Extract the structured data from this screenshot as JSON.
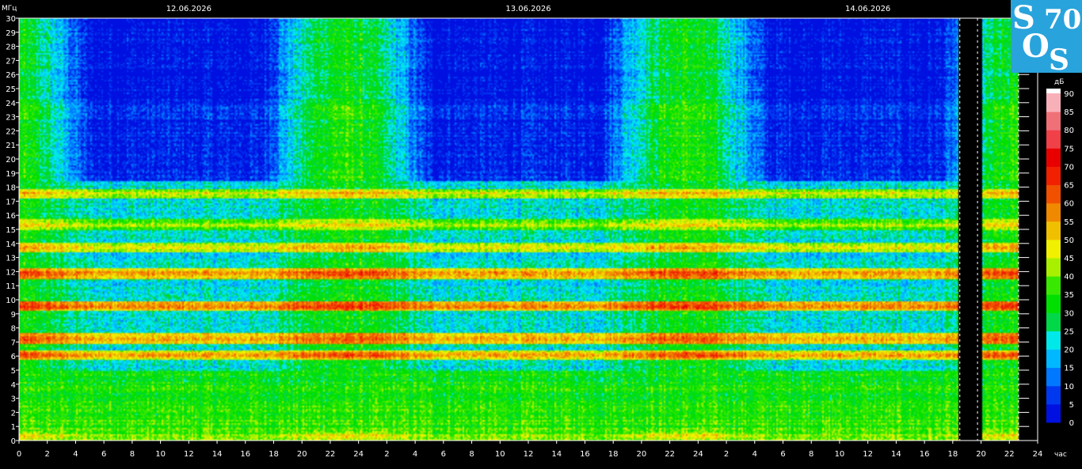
{
  "chart_data": {
    "type": "heatmap",
    "title": "",
    "y_unit_label": "МГц",
    "x_unit_label": "час",
    "colorbar_unit_label": "дБ",
    "dates": [
      "12.06.2026",
      "13.06.2026",
      "14.06.2026"
    ],
    "ylim": [
      0,
      30
    ],
    "y_ticks": [
      0,
      1,
      2,
      3,
      4,
      5,
      6,
      7,
      8,
      9,
      10,
      11,
      12,
      13,
      14,
      15,
      16,
      17,
      18,
      19,
      20,
      21,
      22,
      23,
      24,
      25,
      26,
      27,
      28,
      29,
      30
    ],
    "x_hours_range": [
      0,
      72
    ],
    "x_tick_labels": [
      "0",
      "2",
      "4",
      "6",
      "8",
      "10",
      "12",
      "14",
      "16",
      "18",
      "20",
      "22",
      "24",
      "2",
      "4",
      "6",
      "8",
      "10",
      "12",
      "14",
      "16",
      "18",
      "20",
      "22",
      "24",
      "2",
      "4",
      "6",
      "8",
      "10",
      "12",
      "14",
      "16",
      "18",
      "20",
      "22",
      "24"
    ],
    "data_end_hour": 66.3,
    "gap_hours": [
      66.3,
      68.0
    ],
    "resume_end_hour": 70.6,
    "colorbar_range": [
      0,
      90
    ],
    "colorbar_ticks": [
      0,
      5,
      10,
      15,
      20,
      25,
      30,
      35,
      40,
      45,
      50,
      55,
      60,
      65,
      70,
      75,
      80,
      85,
      90
    ],
    "colorbar_colors": [
      "#0010e0",
      "#0038f0",
      "#0078ff",
      "#00b8ff",
      "#00e8e8",
      "#00d848",
      "#00e000",
      "#38e800",
      "#a8f000",
      "#f0f000",
      "#f0c000",
      "#f08800",
      "#f05000",
      "#f02000",
      "#e80000",
      "#f04048",
      "#f07078",
      "#f8b0b8",
      "#ffffff"
    ],
    "resonance_bands_mhz": [
      {
        "mhz": 0.4,
        "level_db": 48
      },
      {
        "mhz": 6.1,
        "level_db": 62
      },
      {
        "mhz": 7.3,
        "level_db": 65
      },
      {
        "mhz": 9.6,
        "level_db": 68
      },
      {
        "mhz": 11.9,
        "level_db": 66
      },
      {
        "mhz": 13.8,
        "level_db": 58
      },
      {
        "mhz": 15.4,
        "level_db": 52
      },
      {
        "mhz": 17.6,
        "level_db": 55
      }
    ]
  },
  "logo": {
    "text_s1": "S",
    "text_o": "O",
    "text_s2": "S",
    "text_70": "70",
    "bg_color": "#29a3dc"
  }
}
